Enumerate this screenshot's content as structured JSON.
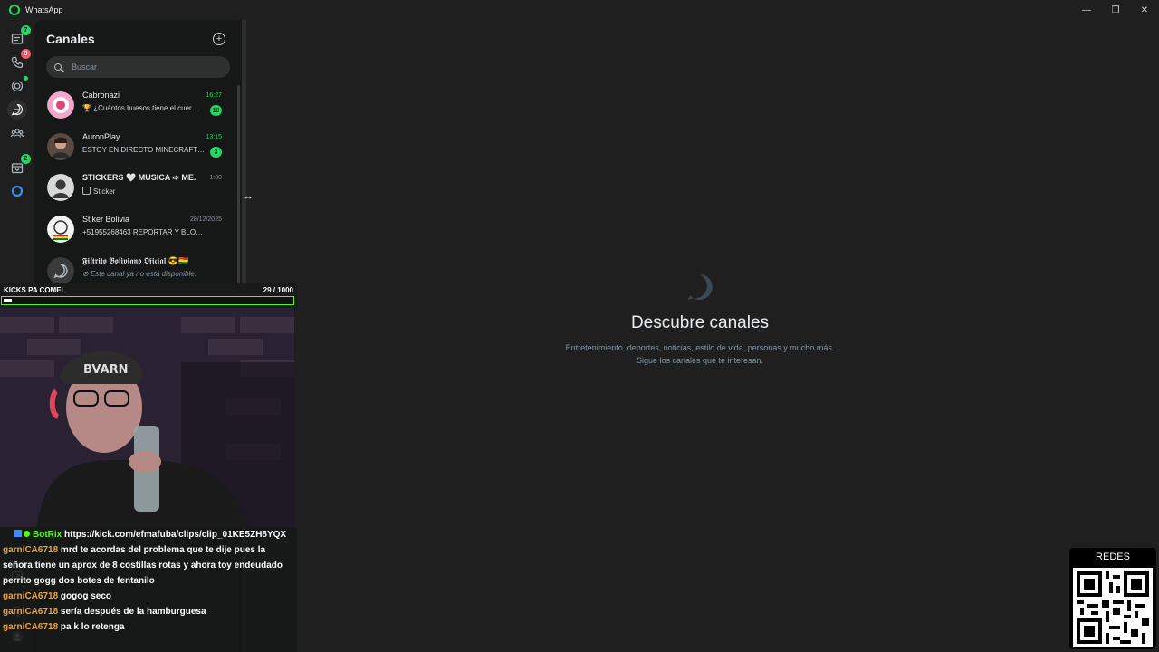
{
  "window": {
    "title": "WhatsApp",
    "controls": [
      "—",
      "❐",
      "✕"
    ]
  },
  "rail": {
    "items": [
      {
        "name": "chats",
        "badge": "7"
      },
      {
        "name": "calls",
        "badge": "3"
      },
      {
        "name": "status",
        "dot": true
      },
      {
        "name": "channels",
        "active": true
      },
      {
        "name": "communities"
      },
      {
        "name": "archived",
        "badge": "2"
      },
      {
        "name": "meta-ai"
      }
    ]
  },
  "panel": {
    "title": "Canales",
    "search_placeholder": "Buscar",
    "channels": [
      {
        "name": "Cabronazi",
        "time": "16:27",
        "message": "🏆 ¿Cuántos huesos tiene el cuer...",
        "badge": "10",
        "time_green": true
      },
      {
        "name": "AuronPlay",
        "time": "13:15",
        "message": "ESTOY EN DIRECTO MINECRAFT H...",
        "badge": "3",
        "time_green": true
      },
      {
        "name": "STICKERS 🤍 MUSICA ➪ ME...",
        "time": "1:00",
        "message": "Sticker"
      },
      {
        "name": "Stiker Bolivia",
        "time": "28/12/2025",
        "message": "+51955268463  REPORTAR Y BLOQUE..."
      },
      {
        "name": "𝕱𝖎𝖑𝖙𝖗𝖎𝖙𝖔 𝕭𝖔𝖑𝖎𝖛𝖎𝖆𝖓𝖔 𝕺𝖋𝖎𝖈𝖎𝖆𝖑 😎🇧🇴",
        "time": "",
        "message": "⊘ Este canal ya no está disponible."
      }
    ]
  },
  "main": {
    "title": "Descubre canales",
    "subtitle_line1": "Entretenimiento, deportes, noticias, estilo de vida, personas y mucho más.",
    "subtitle_line2": "Sigue los canales que te interesan."
  },
  "overlay": {
    "kicks_label": "KICKS PA COMEL",
    "kicks_count": "29  / 1000",
    "kicks_progress": 0.029,
    "chat": [
      {
        "user": "BotRix",
        "text": "https://kick.com/efmafuba/clips/clip_01KE5ZH8YQX",
        "bot": true
      },
      {
        "user": "garniCA6718",
        "text": "mrd te acordas del problema que te dije pues la señora tiene un aprox de 8 costillas rotas y ahora toy endeudado perrito gogg dos botes de fentanilo"
      },
      {
        "user": "garniCA6718",
        "text": "gogog seco"
      },
      {
        "user": "garniCA6718",
        "text": "sería después de la hamburguesa"
      },
      {
        "user": "garniCA6718",
        "text": "pa k lo retenga"
      }
    ],
    "redes_label": "REDES"
  },
  "colors": {
    "accent": "#25d366",
    "kick_green": "#53fc18",
    "background": "#1f1f1f",
    "panel": "#161717"
  }
}
